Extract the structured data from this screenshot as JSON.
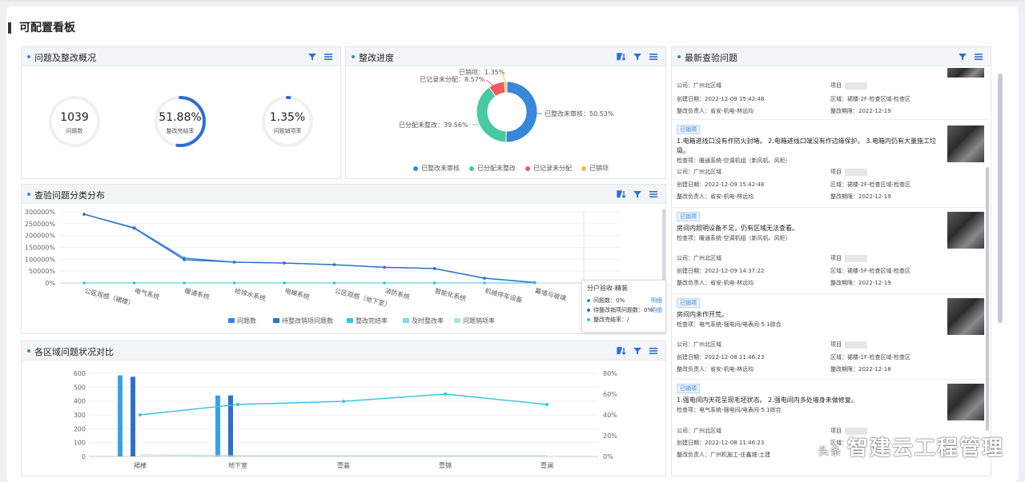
{
  "page": {
    "title": "可配置看板"
  },
  "overview": {
    "title": "问题及整改概况",
    "rings": [
      {
        "value": "1039",
        "label": "问题数",
        "percent": 0
      },
      {
        "value": "51.88%",
        "label": "整改完结率",
        "percent": 51.88
      },
      {
        "value": "1.35%",
        "label": "问题销项率",
        "percent": 1.35
      }
    ]
  },
  "progress": {
    "title": "整改进度",
    "colors": [
      "#3a86d8",
      "#48c9a0",
      "#f05a5a",
      "#f6b94b"
    ],
    "labels": [
      {
        "name": "已整改未审核",
        "text": "已整改未审核：50.53%"
      },
      {
        "name": "已分配未整改",
        "text": "已分配未整改：39.56%"
      },
      {
        "name": "已记录未分配",
        "text": "已记录未分配：8.57%"
      },
      {
        "name": "已销项",
        "text": "已销项：1.35%"
      }
    ],
    "chart_data": {
      "type": "pie",
      "categories": [
        "已整改未审核",
        "已分配未整改",
        "已记录未分配",
        "已销项"
      ],
      "values": [
        50.53,
        39.56,
        8.57,
        1.35
      ]
    }
  },
  "category_dist": {
    "title": "查验问题分类分布",
    "legend": [
      "问题数",
      "待整改销项问题数",
      "整改完结率",
      "及时整改率",
      "问题销项率"
    ],
    "legend_colors": [
      "#3a86d8",
      "#2d72c8",
      "#35c4e0",
      "#7fd8f0",
      "#a8e0e8"
    ],
    "chart_data": {
      "type": "line",
      "categories": [
        "公区观感（裙楼）",
        "电气系统",
        "暖通系统",
        "给排水系统",
        "电梯系统",
        "公区观感（地下室）",
        "消防系统",
        "智能化系统",
        "机械停车设备",
        "幕墙与玻璃"
      ],
      "series": [
        {
          "name": "问题数",
          "values": [
            290000,
            233000,
            105000,
            88000,
            84000,
            77000,
            66000,
            61000,
            20000,
            2000
          ]
        },
        {
          "name": "待整改销项问题数",
          "values": [
            290000,
            231000,
            98000,
            88000,
            84000,
            77000,
            66000,
            61000,
            20000,
            2000
          ]
        },
        {
          "name": "整改完结率",
          "values": [
            0,
            0,
            0,
            0,
            0,
            0,
            0,
            0,
            0,
            0
          ]
        }
      ],
      "yticks": [
        "0%",
        "50000%",
        "100000%",
        "150000%",
        "200000%",
        "250000%",
        "300000%"
      ],
      "ylim": [
        0,
        300000
      ]
    },
    "tooltip": {
      "title": "分户验收-精装",
      "rows": [
        {
          "text": "问题数：0%",
          "link": "明细"
        },
        {
          "text": "待整改销项问题数：0%",
          "link": "明细"
        },
        {
          "text": "整改完结率：/",
          "link": ""
        }
      ]
    }
  },
  "region_compare": {
    "title": "各区域问题状况对比",
    "chart_data": {
      "type": "bar",
      "categories": [
        "裙楼",
        "地下室",
        "壹荟",
        "壹锦",
        "壹澜"
      ],
      "series": [
        {
          "name": "问题数",
          "values": [
            585,
            440,
            0,
            0,
            0
          ]
        },
        {
          "name": "待整改销项问题数",
          "values": [
            575,
            440,
            0,
            0,
            0
          ]
        },
        {
          "name": "整改完结率",
          "values": [
            40,
            50,
            53,
            60,
            50
          ]
        }
      ],
      "yticks_left": [
        "0",
        "100",
        "200",
        "300",
        "400",
        "500",
        "600"
      ],
      "yticks_right": [
        "0%",
        "20%",
        "40%",
        "60%",
        "80%"
      ],
      "ylim": [
        0,
        600
      ],
      "y2lim": [
        0,
        80
      ]
    }
  },
  "latest": {
    "title": "最新查验问题",
    "items": [
      {
        "tag": "",
        "desc": "",
        "check": "",
        "company": "公司：广州北区域",
        "project": "项目",
        "created": "创建日期：2022-12-09 15:42:48",
        "area": "区域：裙楼-2F-检查区域-检查区",
        "owner": "整改负责人：省安-机电-林远均",
        "deadline": "整改期限：2022-12-19"
      },
      {
        "tag": "已销项",
        "desc": "1.电箱进线口没有作防火封堵。 2.电箱进线口端没有作边缘保护。 3.电箱内仍有大量施工垃圾。",
        "check": "检查项：暖通系统-空调机组（新风机、风柜）",
        "company": "公司：广州北区域",
        "project": "项目",
        "created": "创建日期：2022-12-09 15:42:48",
        "area": "区域：裙楼-2F-检查区域-检查区",
        "owner": "整改负责人：省安-机电-林远均",
        "deadline": "整改期限：2022-12-19"
      },
      {
        "tag": "已销项",
        "desc": "房间内照明设备不足，仍有区域无法查看。",
        "check": "检查项：暖通系统-空调机组（新风机、风柜）",
        "company": "公司：广州北区域",
        "project": "项目",
        "created": "创建日期：2022-12-09 14:37:22",
        "area": "区域：裙楼-5F-检查区域-检查区",
        "owner": "整改负责人：省安-机电-林远均",
        "deadline": "整改期限：2022-12-19"
      },
      {
        "tag": "已销项",
        "desc": "房间内未作开荒。",
        "check": "检查项：电气系统-强电间/电表间-5.1综合",
        "company": "公司：广州北区域",
        "project": "项目",
        "created": "创建日期：2022-12-08 11:46:23",
        "area": "区域：裙楼-1F-检查区域-检查区",
        "owner": "整改负责人：省安-机电-林远均",
        "deadline": "整改期限：2022-12-18"
      },
      {
        "tag": "已销项",
        "desc": "1.强电间内天花呈现毛坯状态。 2.强电间内多处墙身未做修复。",
        "check": "检查项：电气系统-强电间/电表间-5.1综合",
        "company": "公司：广州北区域",
        "project": "项目",
        "created": "创建日期：2022-12-08 11:46:23",
        "area": "区域：",
        "owner": "整改负责人：广州机施工-庄鑫城-土建",
        "deadline": ""
      }
    ]
  },
  "watermark": {
    "text": "智建云工程管理",
    "prefix": "头条"
  }
}
